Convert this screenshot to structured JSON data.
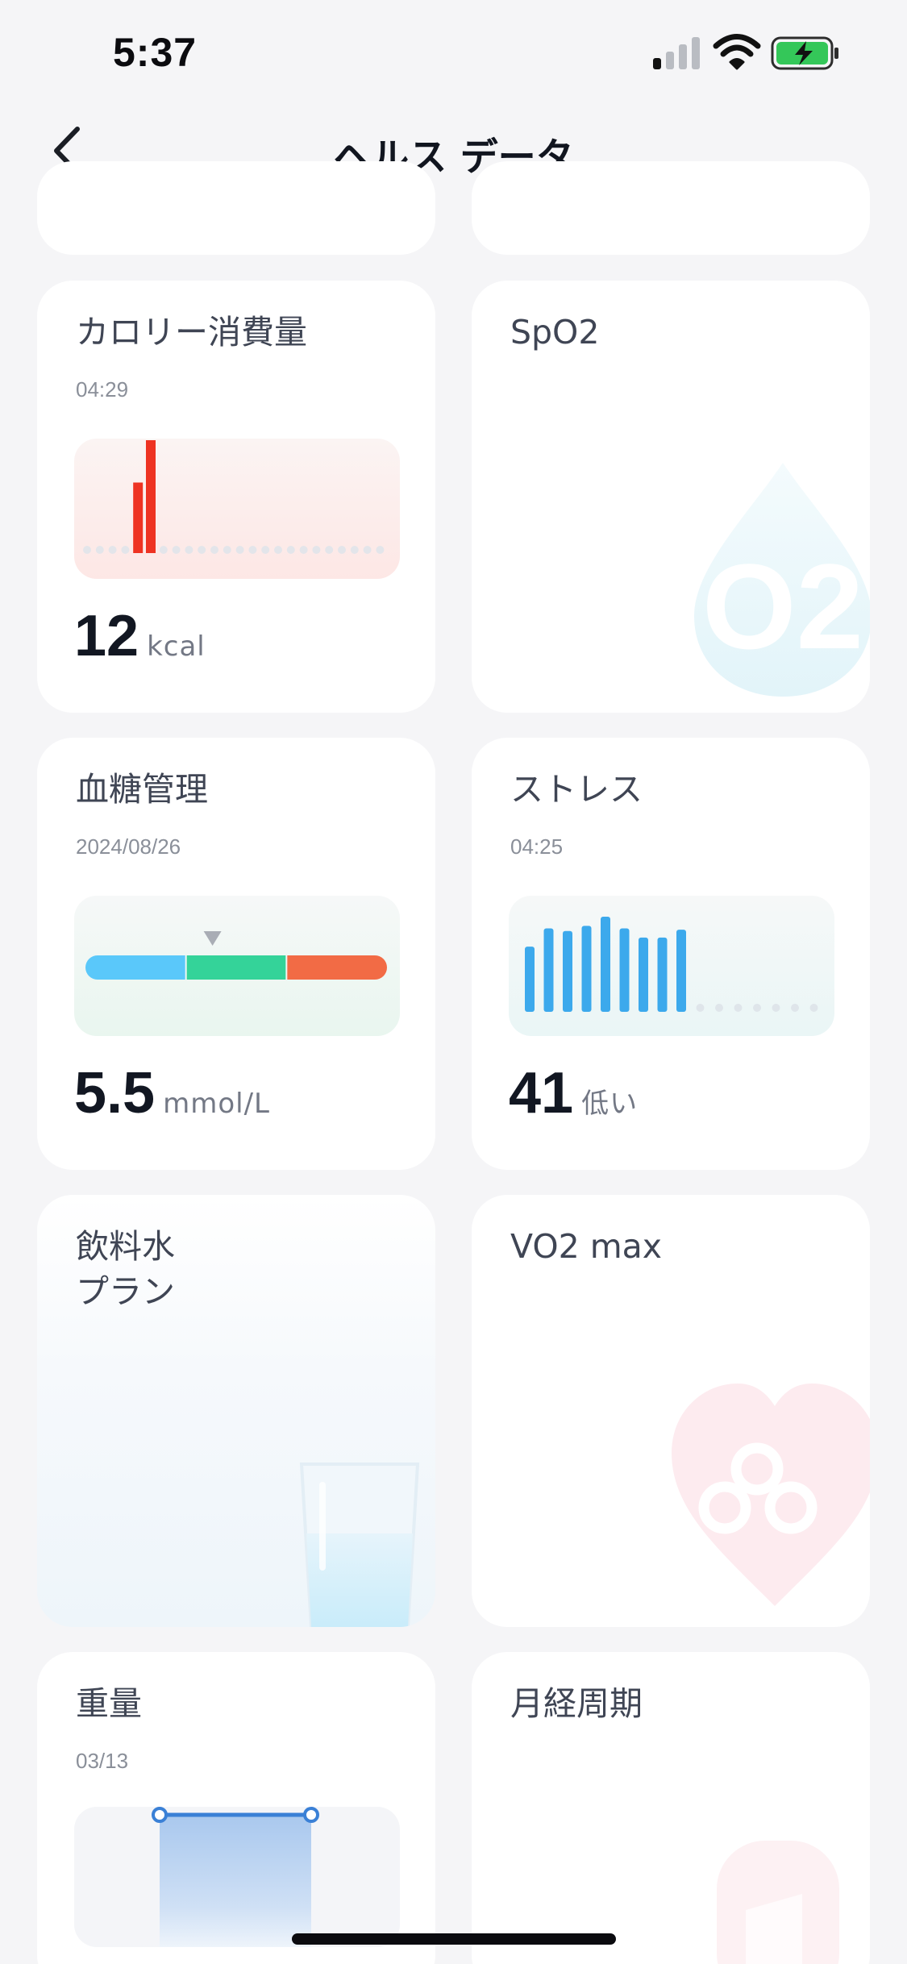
{
  "status": {
    "time": "5:37"
  },
  "header": {
    "title": "ヘルス データ"
  },
  "cards": {
    "calorie": {
      "title": "カロリー消費量",
      "time": "04:29",
      "value": "12",
      "unit": "kcal",
      "chart_data": {
        "type": "bar",
        "values": [
          0,
          0,
          0,
          0,
          10,
          16,
          0,
          0,
          0,
          0,
          0,
          0,
          0,
          0,
          0,
          0,
          0,
          0,
          0,
          0,
          0,
          0,
          0,
          0
        ],
        "color": "#ee3322"
      }
    },
    "spo2": {
      "title": "SpO2",
      "watermark": "O2"
    },
    "glucose": {
      "title": "血糖管理",
      "date": "2024/08/26",
      "value": "5.5",
      "unit": "mmol/L",
      "segment_colors": [
        "#5ac8fa",
        "#34d399",
        "#f26b45"
      ],
      "marker_fraction": 0.4
    },
    "stress": {
      "title": "ストレス",
      "time": "04:25",
      "value": "41",
      "level": "低い",
      "chart_data": {
        "type": "bar",
        "values": [
          50,
          64,
          62,
          66,
          73,
          64,
          57,
          57,
          63
        ],
        "empty_slots": 7,
        "color": "#3ca9ec"
      }
    },
    "water": {
      "title_line1": "飲料水",
      "title_line2": "プラン"
    },
    "vo2": {
      "title": "VO2 max"
    },
    "weight": {
      "title": "重量",
      "date": "03/13"
    },
    "menstrual": {
      "title": "月経周期"
    }
  }
}
